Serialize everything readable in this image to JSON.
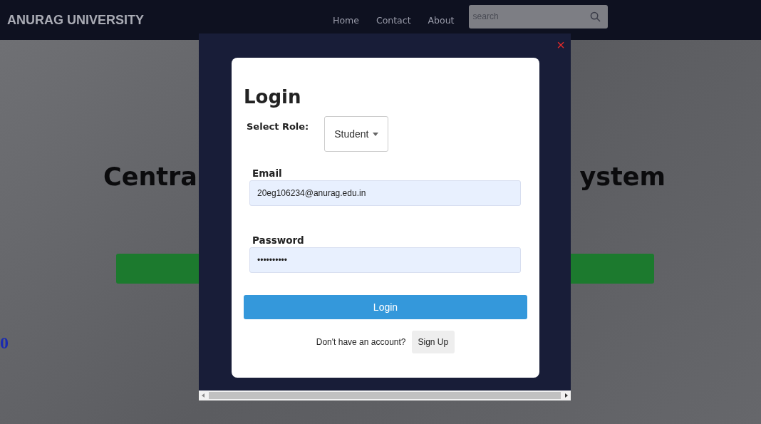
{
  "navbar": {
    "brand": "ANURAG UNIVERSITY",
    "links": [
      {
        "label": "Home"
      },
      {
        "label": "Contact"
      },
      {
        "label": "About"
      }
    ],
    "search": {
      "placeholder": "search"
    }
  },
  "hero": {
    "heading_left": "Centra",
    "heading_right": "ystem",
    "stray_text": "0"
  },
  "login_modal": {
    "close": "×",
    "title": "Login",
    "role_label": "Select Role:",
    "role_value": "Student",
    "fields": [
      {
        "label": "Email",
        "value": "20eg106234@anurag.edu.in"
      },
      {
        "label": "Password",
        "value": "••••••••••"
      }
    ],
    "submit": "Login",
    "signup_prompt": "Don't have an account?",
    "signup_button": "Sign Up"
  }
}
